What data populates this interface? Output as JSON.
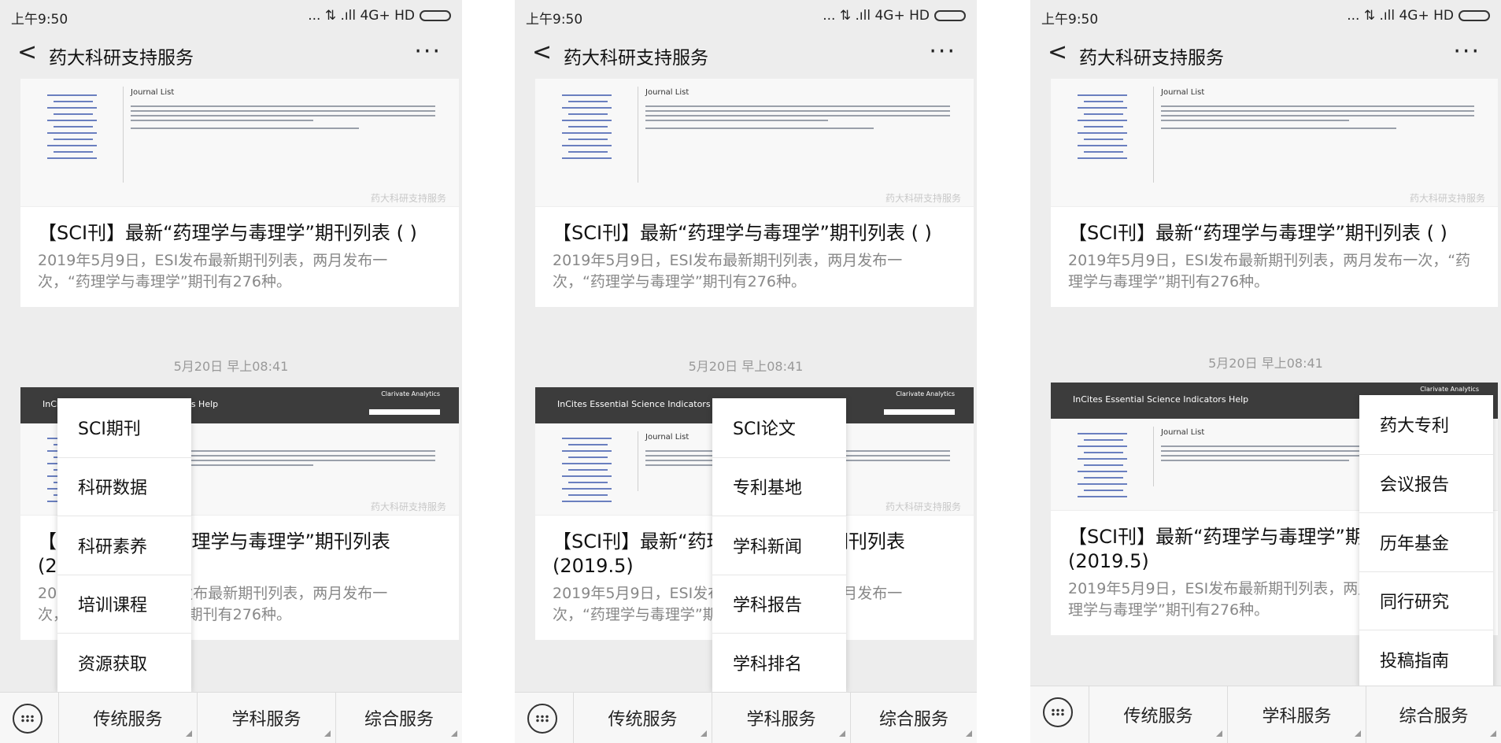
{
  "status": {
    "time": "上午9:50",
    "network": "... ⇅ .ıll 4G+ HD"
  },
  "nav": {
    "back": "<",
    "title": "药大科研支持服务",
    "more": "···"
  },
  "thumb": {
    "journal_list": "Journal List",
    "watermark": "药大科研支持服务",
    "brand_title": "InCites Essential Science Indicators Help",
    "brand_logo": "Clarivate Analytics"
  },
  "timestamp": "5月20日 早上08:41",
  "card1": {
    "title": "【SCI刊】最新“药理学与毒理学”期刊列表 ( )",
    "desc": "2019年5月9日，ESI发布最新期刊列表，两月发布一次，“药理学与毒理学”期刊有276种。"
  },
  "card2": {
    "title": "【SCI刊】最新“药理学与毒理学”期刊列表 (2019.5)",
    "desc": "2019年5月9日，ESI发布最新期刊列表，两月发布一次，“药理学与毒理学”期刊有276种。"
  },
  "tabs": [
    "传统服务",
    "学科服务",
    "综合服务"
  ],
  "menus": {
    "traditional": [
      "SCI期刊",
      "科研数据",
      "科研素养",
      "培训课程",
      "资源获取"
    ],
    "discipline": [
      "SCI论文",
      "专利基地",
      "学科新闻",
      "学科报告",
      "学科排名"
    ],
    "comprehensive": [
      "药大专利",
      "会议报告",
      "历年基金",
      "同行研究",
      "投稿指南"
    ]
  }
}
